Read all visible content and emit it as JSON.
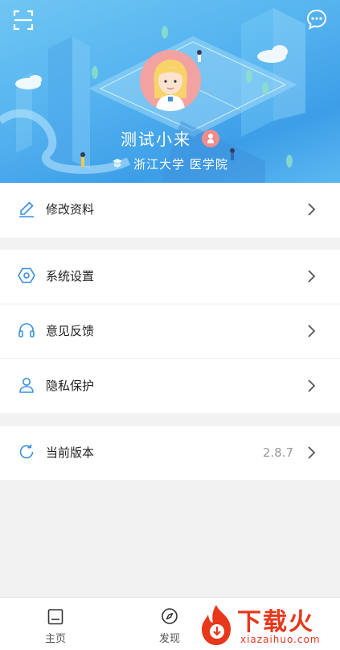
{
  "profile": {
    "name": "测试小来",
    "school": "浙江大学 医学院",
    "gender": "female"
  },
  "menu": {
    "edit_profile": "修改资料",
    "settings": "系统设置",
    "feedback": "意见反馈",
    "privacy": "隐私保护",
    "version_label": "当前版本",
    "version_value": "2.8.7"
  },
  "tabbar": {
    "home": "主页",
    "discover": "发现"
  },
  "watermark": {
    "text": "下载火",
    "url": "xiazaihuo.com"
  },
  "icons": {
    "scan": "scan-icon",
    "message": "message-icon",
    "edit": "edit-icon",
    "settings": "settings-icon",
    "feedback": "headset-icon",
    "privacy": "user-icon",
    "version": "refresh-icon",
    "chevron": "chevron-right-icon",
    "home": "home-icon",
    "discover": "compass-icon"
  },
  "colors": {
    "header_blue": "#56b4ef",
    "icon_blue": "#3a8fe0",
    "watermark_red": "#e8371a"
  }
}
